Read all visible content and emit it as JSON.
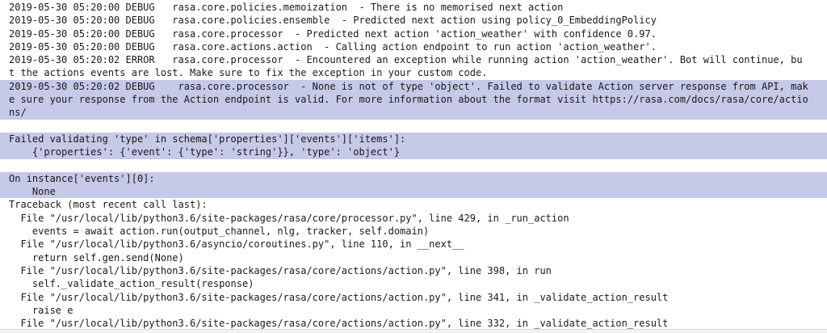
{
  "colors": {
    "highlight": "#c6c9e7",
    "text": "#1a1a1a",
    "background": "#ffffff"
  },
  "log_lines": [
    {
      "text": "2019-05-30 05:20:00 DEBUG   rasa.core.policies.memoization  - There is no memorised next action",
      "hl": false
    },
    {
      "text": "2019-05-30 05:20:00 DEBUG   rasa.core.policies.ensemble  - Predicted next action using policy_0_EmbeddingPolicy",
      "hl": false
    },
    {
      "text": "2019-05-30 05:20:00 DEBUG   rasa.core.processor  - Predicted next action 'action_weather' with confidence 0.97.",
      "hl": false
    },
    {
      "text": "2019-05-30 05:20:00 DEBUG   rasa.core.actions.action  - Calling action endpoint to run action 'action_weather'.",
      "hl": false
    },
    {
      "text": "2019-05-30 05:20:02 ERROR   rasa.core.processor  - Encountered an exception while running action 'action_weather'. Bot will continue, bu",
      "hl": false
    },
    {
      "text": "t the actions events are lost. Make sure to fix the exception in your custom code.",
      "hl": false
    },
    {
      "text": "2019-05-30 05:20:02 DEBUG    rasa.core.processor  - None is not of type 'object'. Failed to validate Action server response from API, mak",
      "hl": true
    },
    {
      "text": "e sure your response from the Action endpoint is valid. For more information about the format visit https://rasa.com/docs/rasa/core/actio",
      "hl": true
    },
    {
      "text": "ns/",
      "hl": true
    },
    {
      "text": "",
      "hl": false
    },
    {
      "text": "Failed validating 'type' in schema['properties']['events']['items']:",
      "hl": true
    },
    {
      "text": "    {'properties': {'event': {'type': 'string'}}, 'type': 'object'}",
      "hl": true
    },
    {
      "text": "",
      "hl": false
    },
    {
      "text": "On instance['events'][0]:",
      "hl": true
    },
    {
      "text": "    None",
      "hl": true
    },
    {
      "text": "Traceback (most recent call last):",
      "hl": false
    },
    {
      "text": "  File \"/usr/local/lib/python3.6/site-packages/rasa/core/processor.py\", line 429, in _run_action",
      "hl": false
    },
    {
      "text": "    events = await action.run(output_channel, nlg, tracker, self.domain)",
      "hl": false
    },
    {
      "text": "  File \"/usr/local/lib/python3.6/asyncio/coroutines.py\", line 110, in __next__",
      "hl": false
    },
    {
      "text": "    return self.gen.send(None)",
      "hl": false
    },
    {
      "text": "  File \"/usr/local/lib/python3.6/site-packages/rasa/core/actions/action.py\", line 398, in run",
      "hl": false
    },
    {
      "text": "    self._validate_action_result(response)",
      "hl": false
    },
    {
      "text": "  File \"/usr/local/lib/python3.6/site-packages/rasa/core/actions/action.py\", line 341, in _validate_action_result",
      "hl": false
    },
    {
      "text": "    raise e",
      "hl": false
    },
    {
      "text": "  File \"/usr/local/lib/python3.6/site-packages/rasa/core/actions/action.py\", line 332, in _validate_action_result",
      "hl": false
    }
  ]
}
